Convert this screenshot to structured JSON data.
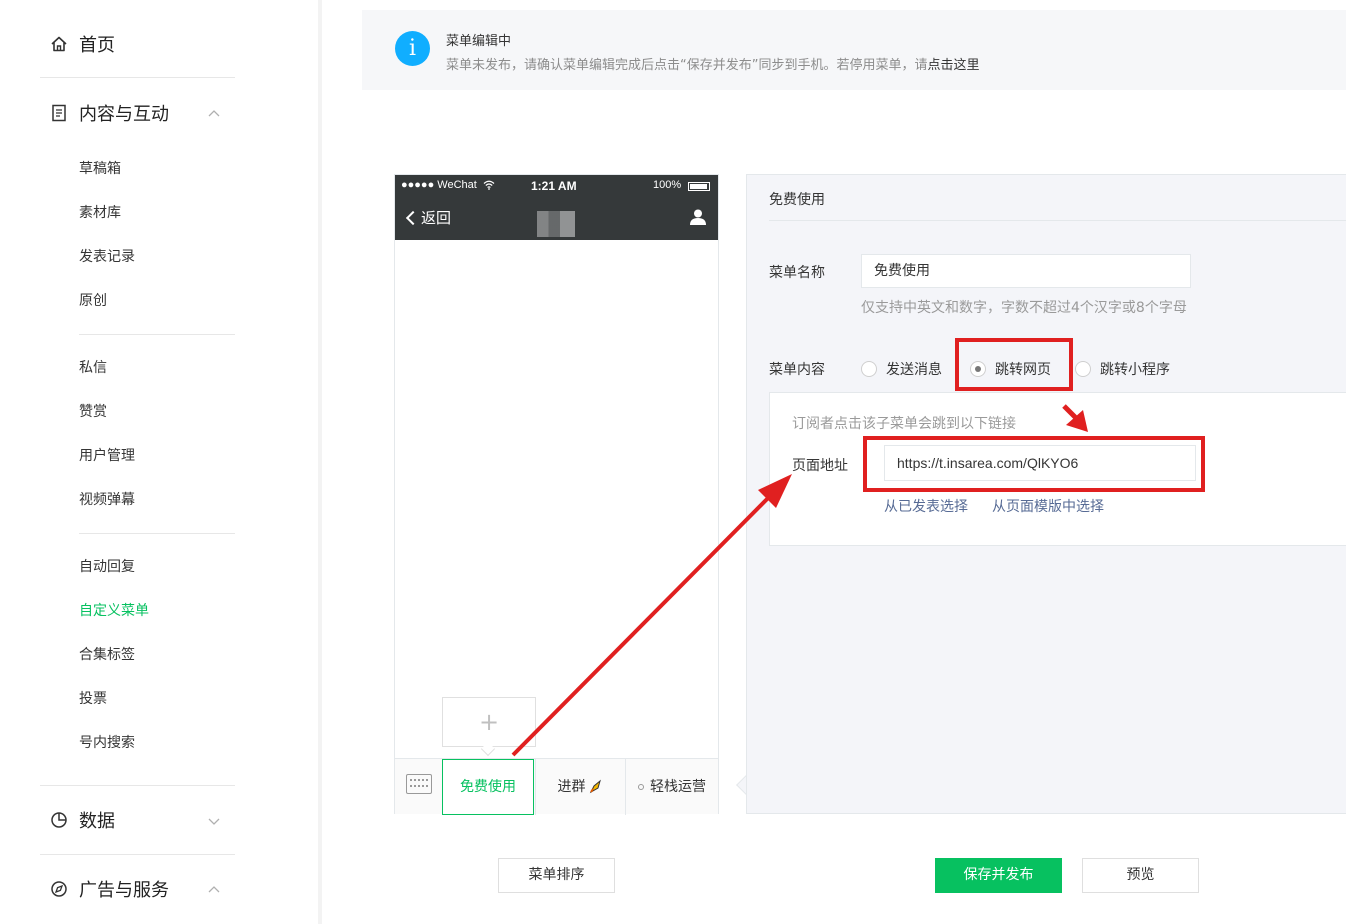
{
  "sidebar": {
    "home": "首页",
    "content_group": "内容与互动",
    "content_items": [
      "草稿箱",
      "素材库",
      "发表记录",
      "原创"
    ],
    "interaction_items": [
      "私信",
      "赞赏",
      "用户管理",
      "视频弹幕"
    ],
    "function_items": [
      "自动回复",
      "自定义菜单",
      "合集标签",
      "投票",
      "号内搜索"
    ],
    "active_item": "自定义菜单",
    "data_group": "数据",
    "ads_group": "广告与服务"
  },
  "notice": {
    "icon": "i",
    "title": "菜单编辑中",
    "desc": "菜单未发布，请确认菜单编辑完成后点击“保存并发布”同步到手机。若停用菜单，请",
    "link": "点击这里"
  },
  "phone": {
    "carrier": "●●●●● WeChat",
    "time": "1:21 AM",
    "battery": "100%",
    "back": "返回",
    "add_symbol": "+",
    "menu_tabs": [
      "免费使用",
      "进群",
      "轻栈运营"
    ]
  },
  "editor": {
    "header": "免费使用",
    "name_label": "菜单名称",
    "name_value": "免费使用",
    "name_tip": "仅支持中英文和数字，字数不超过4个汉字或8个字母",
    "content_label": "菜单内容",
    "radios": [
      "发送消息",
      "跳转网页",
      "跳转小程序"
    ],
    "selected_radio": "跳转网页",
    "url_tip": "订阅者点击该子菜单会跳到以下链接",
    "url_label": "页面地址",
    "url_value": "https://t.insarea.com/QlKYO6",
    "links": [
      "从已发表选择",
      "从页面模版中选择"
    ]
  },
  "buttons": {
    "sort": "菜单排序",
    "publish": "保存并发布",
    "preview": "预览"
  },
  "colors": {
    "accent": "#07c160",
    "annotation": "#e02020",
    "info": "#10aeff"
  }
}
